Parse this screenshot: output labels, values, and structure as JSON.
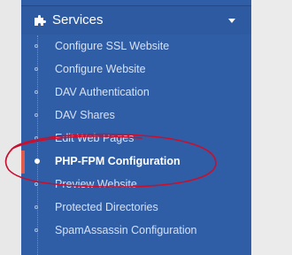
{
  "services": {
    "title": "Services",
    "icon": "puzzle-piece-icon",
    "expanded": true
  },
  "menu": {
    "items": [
      {
        "label": "Configure SSL Website",
        "active": false
      },
      {
        "label": "Configure Website",
        "active": false
      },
      {
        "label": "DAV Authentication",
        "active": false
      },
      {
        "label": "DAV Shares",
        "active": false
      },
      {
        "label": "Edit Web Pages",
        "active": false
      },
      {
        "label": "PHP-FPM Configuration",
        "active": true
      },
      {
        "label": "Preview Website",
        "active": false
      },
      {
        "label": "Protected Directories",
        "active": false
      },
      {
        "label": "SpamAssassin Configuration",
        "active": false
      }
    ]
  },
  "colors": {
    "sidebar_bg": "#2f5da6",
    "active_marker": "#e05b4b",
    "annotation": "#c8102e"
  }
}
